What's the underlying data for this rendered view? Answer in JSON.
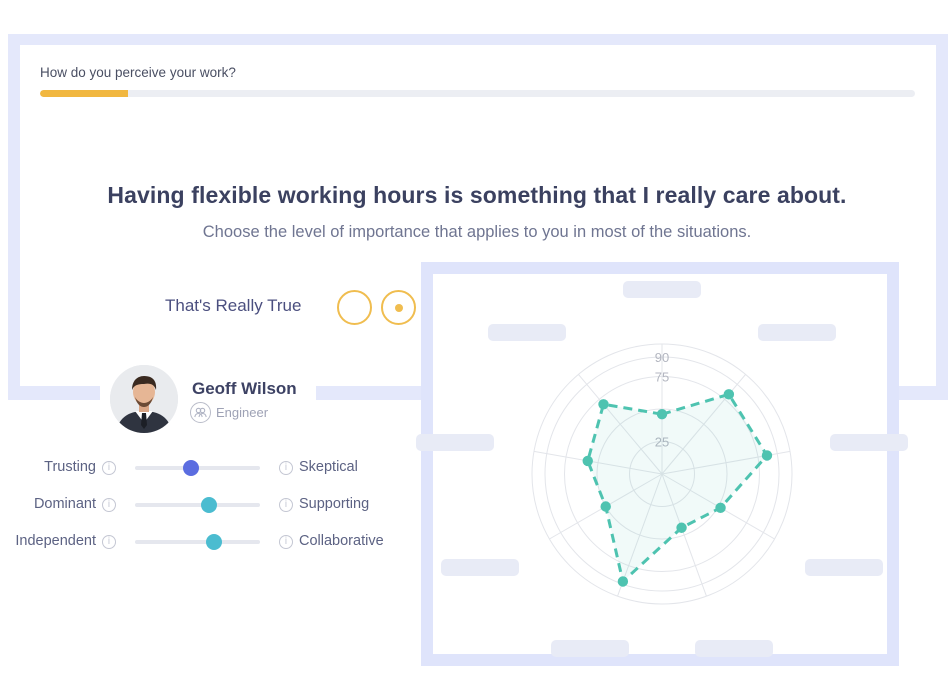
{
  "survey": {
    "question_title": "How do you perceive your work?",
    "progress_fraction": 0.1,
    "statement": "Having flexible working hours is something that I really care about.",
    "instruction": "Choose the level of importance that applies to you in most of the situations.",
    "answer_label": "That's Really True",
    "answer_options": [
      {
        "selected": false
      },
      {
        "selected": true
      }
    ],
    "accent_color": "#f1b740"
  },
  "profile": {
    "name": "Geoff Wilson",
    "role": "Engineer",
    "role_icon": "users-icon"
  },
  "traits": [
    {
      "left": "Trusting",
      "right": "Skeptical",
      "value": 0.45,
      "color": "#5b6de0"
    },
    {
      "left": "Dominant",
      "right": "Supporting",
      "value": 0.59,
      "color": "#4bbcd0"
    },
    {
      "left": "Independent",
      "right": "Collaborative",
      "value": 0.63,
      "color": "#4bbcd0"
    }
  ],
  "chart_data": {
    "type": "radar",
    "rmax": 100,
    "ring_values": [
      25,
      50,
      75,
      90,
      100
    ],
    "ring_labels": [
      "25",
      "75",
      "90"
    ],
    "series": [
      {
        "values": [
          46,
          80,
          82,
          52,
          44,
          88,
          50,
          58,
          70
        ],
        "color": "#4ec3b0"
      }
    ],
    "axis_labels_visible": false
  }
}
